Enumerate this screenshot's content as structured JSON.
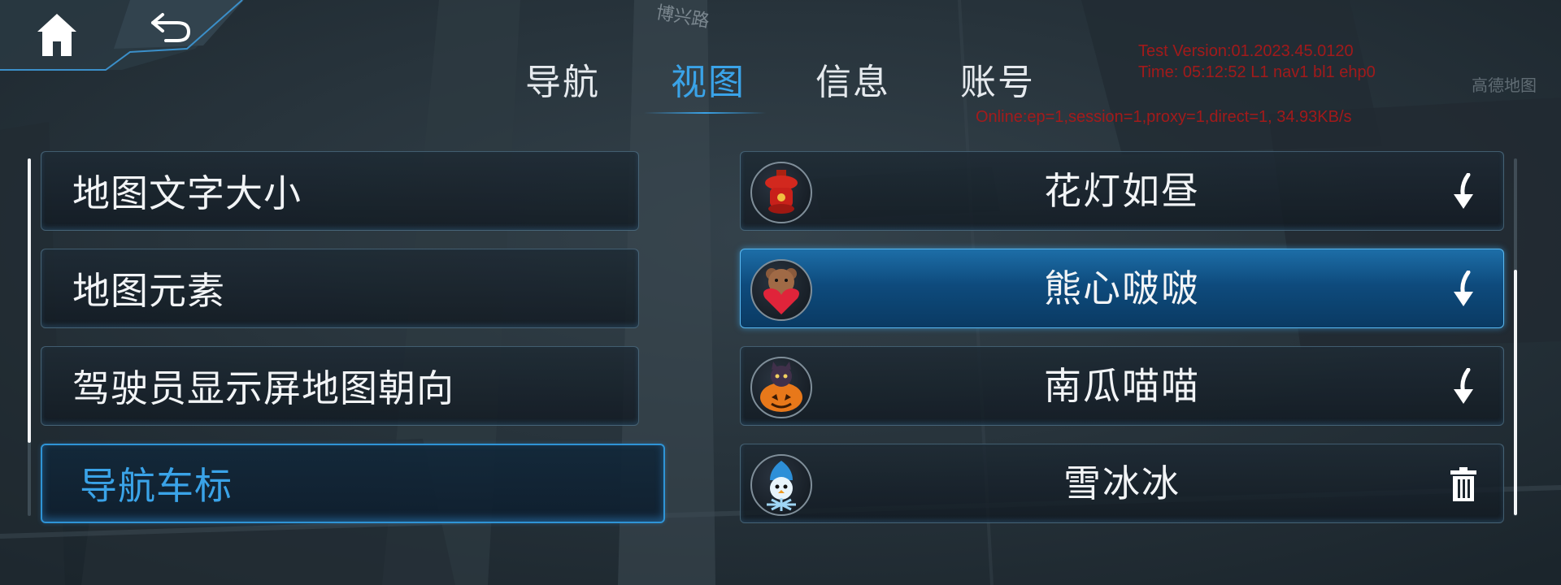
{
  "nav": {
    "home_label": "home",
    "back_label": "back"
  },
  "tabs": [
    {
      "label": "导航",
      "active": false
    },
    {
      "label": "视图",
      "active": true
    },
    {
      "label": "信息",
      "active": false
    },
    {
      "label": "账号",
      "active": false
    }
  ],
  "debug": {
    "version": "Test Version:01.2023.45.0120",
    "time": "Time: 05:12:52 L1 nav1 bl1 ehp0",
    "online": "Online:ep=1,session=1,proxy=1,direct=1, 34.93KB/s"
  },
  "map_labels": {
    "road": "博兴路",
    "top_right": "高德地图"
  },
  "settings_menu": [
    {
      "label": "地图文字大小",
      "selected": false
    },
    {
      "label": "地图元素",
      "selected": false
    },
    {
      "label": "驾驶员显示屏地图朝向",
      "selected": false
    },
    {
      "label": "导航车标",
      "selected": true
    }
  ],
  "car_icons": [
    {
      "label": "花灯如昼",
      "icon": "lantern-icon",
      "action": "download-icon",
      "selected": false
    },
    {
      "label": "熊心啵啵",
      "icon": "bear-heart-icon",
      "action": "download-icon",
      "selected": true
    },
    {
      "label": "南瓜喵喵",
      "icon": "pumpkin-cat-icon",
      "action": "download-icon",
      "selected": false
    },
    {
      "label": "雪冰冰",
      "icon": "snow-bird-icon",
      "action": "trash-icon",
      "selected": false
    }
  ],
  "colors": {
    "accent": "#3aa3e8",
    "selected_fill": "#0e4b7d",
    "debug_text": "#b01818"
  }
}
